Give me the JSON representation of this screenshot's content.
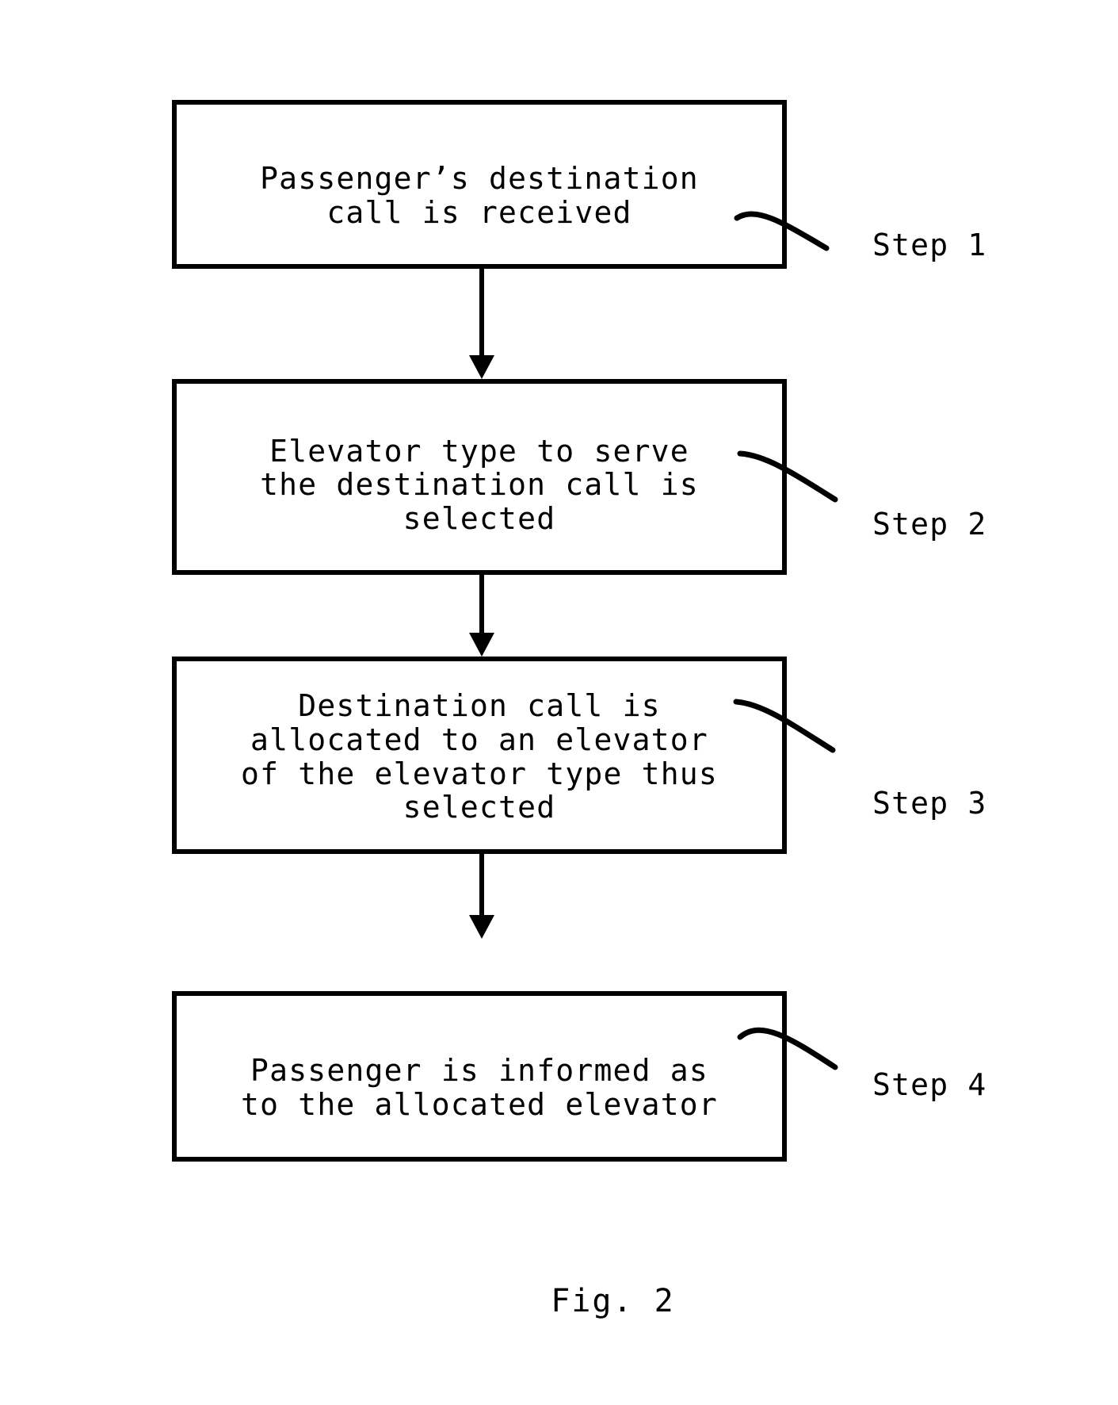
{
  "figure": {
    "caption": "Fig. 2",
    "type": "process-flowchart",
    "orientation": "vertical-top-to-bottom"
  },
  "flowchart": {
    "nodes": [
      {
        "id": "step-1",
        "text": "Passenger’s destination\ncall is received",
        "caption": "Step 1"
      },
      {
        "id": "step-2",
        "text": "Elevator type to serve\nthe destination call is\nselected",
        "caption": "Step 2"
      },
      {
        "id": "step-3",
        "text": "Destination call is\nallocated to an elevator\nof the elevator type thus\nselected",
        "caption": "Step 3"
      },
      {
        "id": "step-4",
        "text": "Passenger is informed as\nto the allocated elevator",
        "caption": "Step 4"
      }
    ],
    "connectors": [
      {
        "id": "arrow-1-to-2",
        "from": "step-1",
        "to": "step-2",
        "style": "solid-down-arrow"
      },
      {
        "id": "arrow-2-to-3",
        "from": "step-2",
        "to": "step-3",
        "style": "solid-down-arrow"
      },
      {
        "id": "arrow-3-to-4",
        "from": "step-3",
        "to": "step-4",
        "style": "solid-down-arrow"
      }
    ],
    "leaders": [
      {
        "id": "leader-step-1",
        "points_to": "step-1"
      },
      {
        "id": "leader-step-2",
        "points_to": "step-2"
      },
      {
        "id": "leader-step-3",
        "points_to": "step-3"
      },
      {
        "id": "leader-step-4",
        "points_to": "step-4"
      }
    ]
  },
  "colors": {
    "stroke": "#000000",
    "background": "#ffffff",
    "text": "#000000"
  }
}
